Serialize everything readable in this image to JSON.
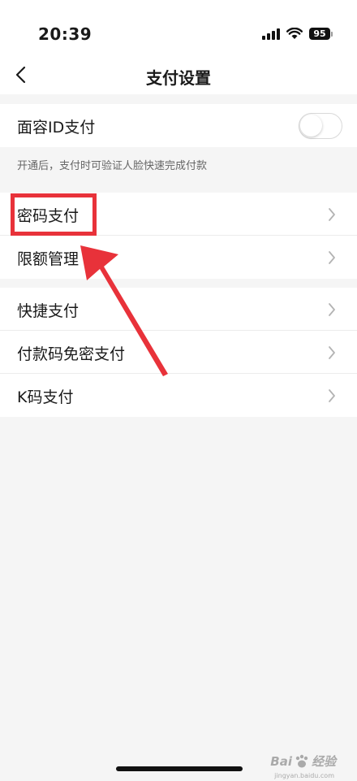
{
  "status_bar": {
    "time": "20:39",
    "battery": "95",
    "icons": [
      "signal-icon",
      "wifi-icon",
      "battery-icon"
    ]
  },
  "nav": {
    "title": "支付设置",
    "back_icon": "chevron-left-icon"
  },
  "face_id": {
    "label": "面容ID支付",
    "enabled": false,
    "hint": "开通后，支付时可验证人脸快速完成付款"
  },
  "group_security": {
    "items": [
      {
        "label": "密码支付"
      },
      {
        "label": "限额管理"
      }
    ]
  },
  "group_payment": {
    "items": [
      {
        "label": "快捷支付"
      },
      {
        "label": "付款码免密支付"
      },
      {
        "label": "K码支付"
      }
    ]
  },
  "annotation": {
    "color": "#e8323a"
  },
  "watermark": {
    "brand": "Bai",
    "suffix": "经验",
    "domain": "jingyan.baidu.com"
  },
  "colors": {
    "background": "#f5f5f5",
    "surface": "#ffffff",
    "text": "#1a1a1a",
    "secondary_text": "#666666",
    "chevron": "#b3b3b3"
  }
}
